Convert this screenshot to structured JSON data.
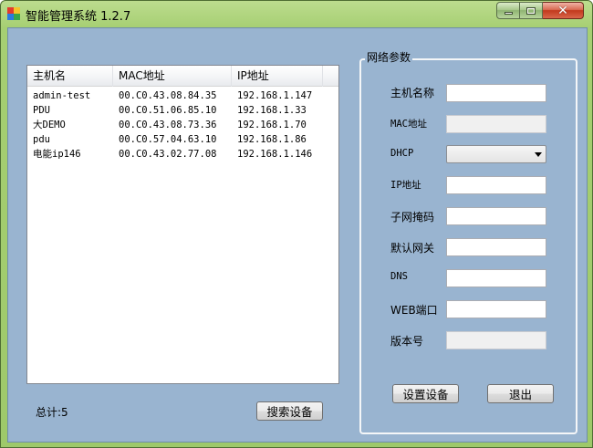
{
  "window": {
    "title": "智能管理系统 1.2.7"
  },
  "list": {
    "columns": [
      "主机名",
      "MAC地址",
      "IP地址"
    ],
    "rows": [
      {
        "host": "admin-test",
        "mac": "00.C0.43.08.84.35",
        "ip": "192.168.1.147"
      },
      {
        "host": "PDU",
        "mac": "00.C0.51.06.85.10",
        "ip": "192.168.1.33"
      },
      {
        "host": "大DEMO",
        "mac": "00.C0.43.08.73.36",
        "ip": "192.168.1.70"
      },
      {
        "host": "pdu",
        "mac": "00.C0.57.04.63.10",
        "ip": "192.168.1.86"
      },
      {
        "host": "电能ip146",
        "mac": "00.C0.43.02.77.08",
        "ip": "192.168.1.146"
      }
    ]
  },
  "footer": {
    "total_label": "总计:5",
    "search_button": "搜索设备"
  },
  "network": {
    "group_title": "网络参数",
    "hostname_label": "主机名称",
    "hostname_value": "",
    "mac_label": "MAC地址",
    "mac_value": "",
    "dhcp_label": "DHCP",
    "dhcp_value": "",
    "ip_label": "IP地址",
    "ip_value": "",
    "subnet_label": "子网掩码",
    "subnet_value": "",
    "gateway_label": "默认网关",
    "gateway_value": "",
    "dns_label": "DNS",
    "dns_value": "",
    "web_port_label": "WEB端口",
    "web_port_value": "",
    "version_label": "版本号",
    "version_value": "",
    "set_button": "设置设备",
    "exit_button": "退出"
  },
  "icons": {
    "app": "app-icon",
    "minimize": "minimize-icon",
    "maximize": "maximize-icon",
    "close": "close-icon",
    "dropdown": "chevron-down-icon"
  }
}
